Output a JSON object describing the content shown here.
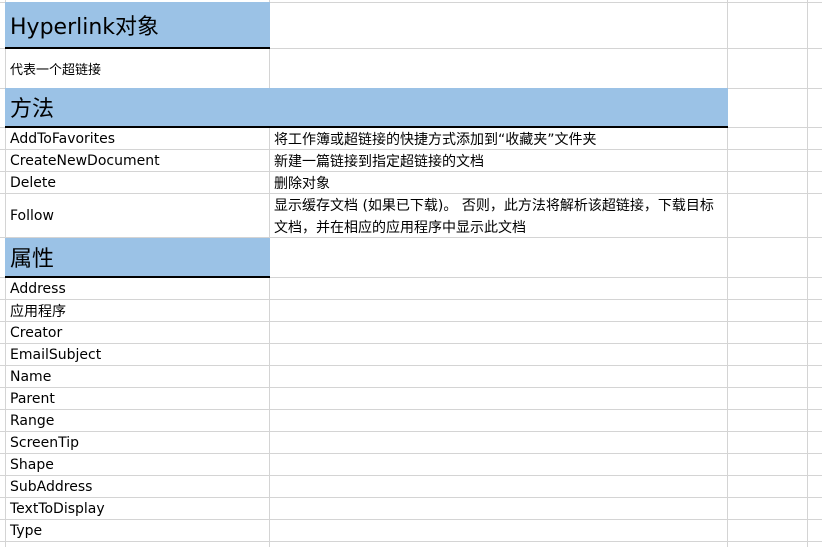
{
  "title": "Hyperlink对象",
  "subtitle": "代表一个超链接",
  "methods_header": "方法",
  "methods": [
    {
      "name": "AddToFavorites",
      "desc": "将工作簿或超链接的快捷方式添加到“收藏夹”文件夹"
    },
    {
      "name": "CreateNewDocument",
      "desc": "新建一篇链接到指定超链接的文档"
    },
    {
      "name": "Delete",
      "desc": "删除对象"
    },
    {
      "name": "Follow",
      "desc": "显示缓存文档 (如果已下载)。 否则，此方法将解析该超链接，下载目标文档，并在相应的应用程序中显示此文档"
    }
  ],
  "properties_header": "属性",
  "properties": [
    "Address",
    "应用程序",
    "Creator",
    "EmailSubject",
    "Name",
    "Parent",
    "Range",
    "ScreenTip",
    "Shape",
    "SubAddress",
    "TextToDisplay",
    "Type"
  ],
  "colors": {
    "header_fill": "#9bc2e6",
    "gridline": "#d4d4d4"
  }
}
